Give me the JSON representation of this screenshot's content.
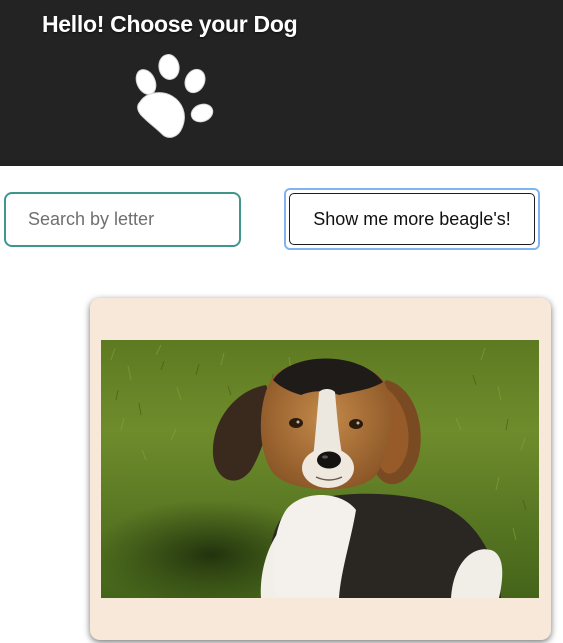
{
  "header": {
    "title": "Hello! Choose your Dog",
    "logo_icon": "paw-print-icon",
    "background": "#232323"
  },
  "search": {
    "placeholder": "Search by letter",
    "value": "",
    "border_color": "#3e968c"
  },
  "more_button": {
    "label": "Show me more beagle's!",
    "focus_ring_color": "#7fb4ee"
  },
  "card": {
    "background": "#f7e8d9",
    "image": {
      "subject": "beagle-puppy-photo"
    }
  }
}
